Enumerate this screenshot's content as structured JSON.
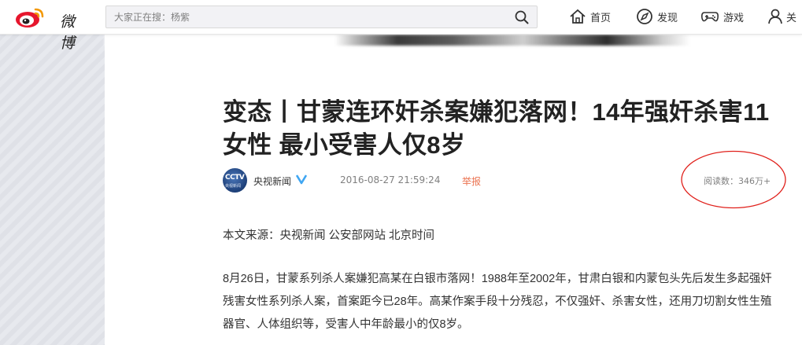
{
  "header": {
    "logo_text": "微博",
    "search_placeholder": "大家正在搜：杨紫",
    "nav": [
      {
        "label": "首页",
        "icon": "home-icon"
      },
      {
        "label": "发现",
        "icon": "compass-icon"
      },
      {
        "label": "游戏",
        "icon": "gamepad-icon"
      },
      {
        "label": "关",
        "icon": "user-icon"
      }
    ]
  },
  "article": {
    "title": "变态丨甘蒙连环奸杀案嫌犯落网！14年强奸杀害11女性 最小受害人仅8岁",
    "author": "央视新闻",
    "avatar_text": "CCTV",
    "avatar_sub": "央视新闻",
    "date": "2016-08-27 21:59:24",
    "report_label": "举报",
    "reads": "阅读数：346万+",
    "source": "本文来源：央视新闻 公安部网站 北京时间",
    "body": "8月26日，甘蒙系列杀人案嫌犯高某在白银市落网！1988年至2002年，甘肃白银和内蒙包头先后发生多起强奸残害女性系列杀人案，首案距今已28年。高某作案手段十分残忍，不仅强奸、杀害女性，还用刀切割女性生殖器官、人体组织等，受害人中年龄最小的仅8岁。"
  },
  "colors": {
    "accent": "#eb7350",
    "verified": "#3fa6f2",
    "annotation": "#e0201b"
  }
}
